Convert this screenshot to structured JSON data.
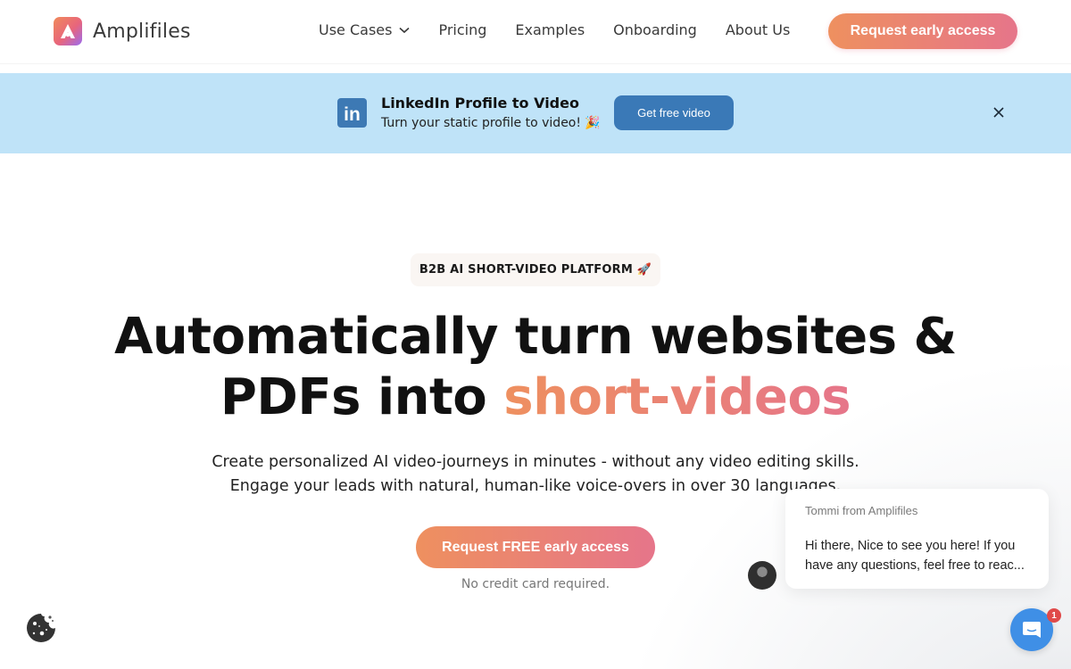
{
  "header": {
    "brand": "Amplifiles",
    "nav": [
      {
        "label": "Use Cases",
        "has_dropdown": true
      },
      {
        "label": "Pricing"
      },
      {
        "label": "Examples"
      },
      {
        "label": "Onboarding"
      },
      {
        "label": "About Us"
      }
    ],
    "cta_label": "Request early access"
  },
  "banner": {
    "icon": "linkedin-icon",
    "title": "LinkedIn Profile to Video",
    "subtitle": "Turn your static profile to video! 🎉",
    "button_label": "Get free video",
    "close_icon": "close-icon"
  },
  "hero": {
    "pill": "B2B AI SHORT-VIDEO PLATFORM 🚀",
    "title_line1": "Automatically turn websites &",
    "title_line2_plain": "PDFs into ",
    "title_line2_accent": "short-videos",
    "subtitle_line1": "Create personalized AI video-journeys in minutes - without any video editing skills.",
    "subtitle_line2": "Engage your leads with natural, human-like voice-overs in over 30 languages.",
    "cta_label": "Request FREE early access",
    "note": "No credit card required."
  },
  "chat": {
    "from": "Tommi from Amplifiles",
    "message": "Hi there, Nice to see you here! If you have any questions, feel free to reac...",
    "unread_count": "1"
  },
  "colors": {
    "accent_start": "#ee905f",
    "accent_end": "#e6758a",
    "banner_bg": "#bfe3f8",
    "banner_button": "#3a79b7",
    "chat_launcher": "#3f8fe6",
    "badge": "#e04a4a"
  }
}
